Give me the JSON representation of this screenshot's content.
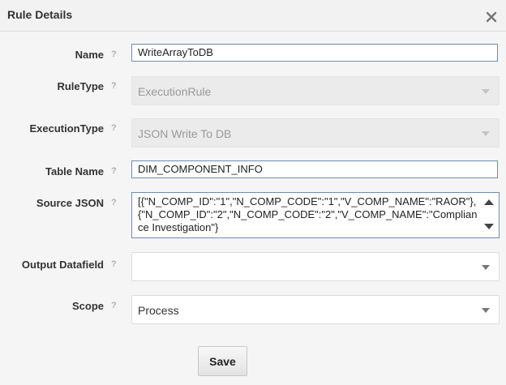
{
  "dialog": {
    "title": "Rule Details",
    "close_icon": "close-icon"
  },
  "help_glyph": "?",
  "fields": {
    "name": {
      "label": "Name",
      "value": "WriteArrayToDB"
    },
    "rule_type": {
      "label": "RuleType",
      "value": "ExecutionRule",
      "disabled": true
    },
    "execution_type": {
      "label": "ExecutionType",
      "value": "JSON Write To DB",
      "disabled": true
    },
    "table_name": {
      "label": "Table Name",
      "value": "DIM_COMPONENT_INFO"
    },
    "source_json": {
      "label": "Source JSON",
      "value": "[{\"N_COMP_ID\":\"1\",\"N_COMP_CODE\":\"1\",\"V_COMP_NAME\":\"RAOR\"},{\"N_COMP_ID\":\"2\",\"N_COMP_CODE\":\"2\",\"V_COMP_NAME\":\"Compliance Investigation\"}"
    },
    "output_datafield": {
      "label": "Output Datafield",
      "value": ""
    },
    "scope": {
      "label": "Scope",
      "value": "Process"
    }
  },
  "buttons": {
    "save_label": "Save"
  },
  "colors": {
    "input_border": "#6b8db1",
    "disabled_bg": "#ebebeb",
    "help_icon": "#b0b0b0"
  }
}
